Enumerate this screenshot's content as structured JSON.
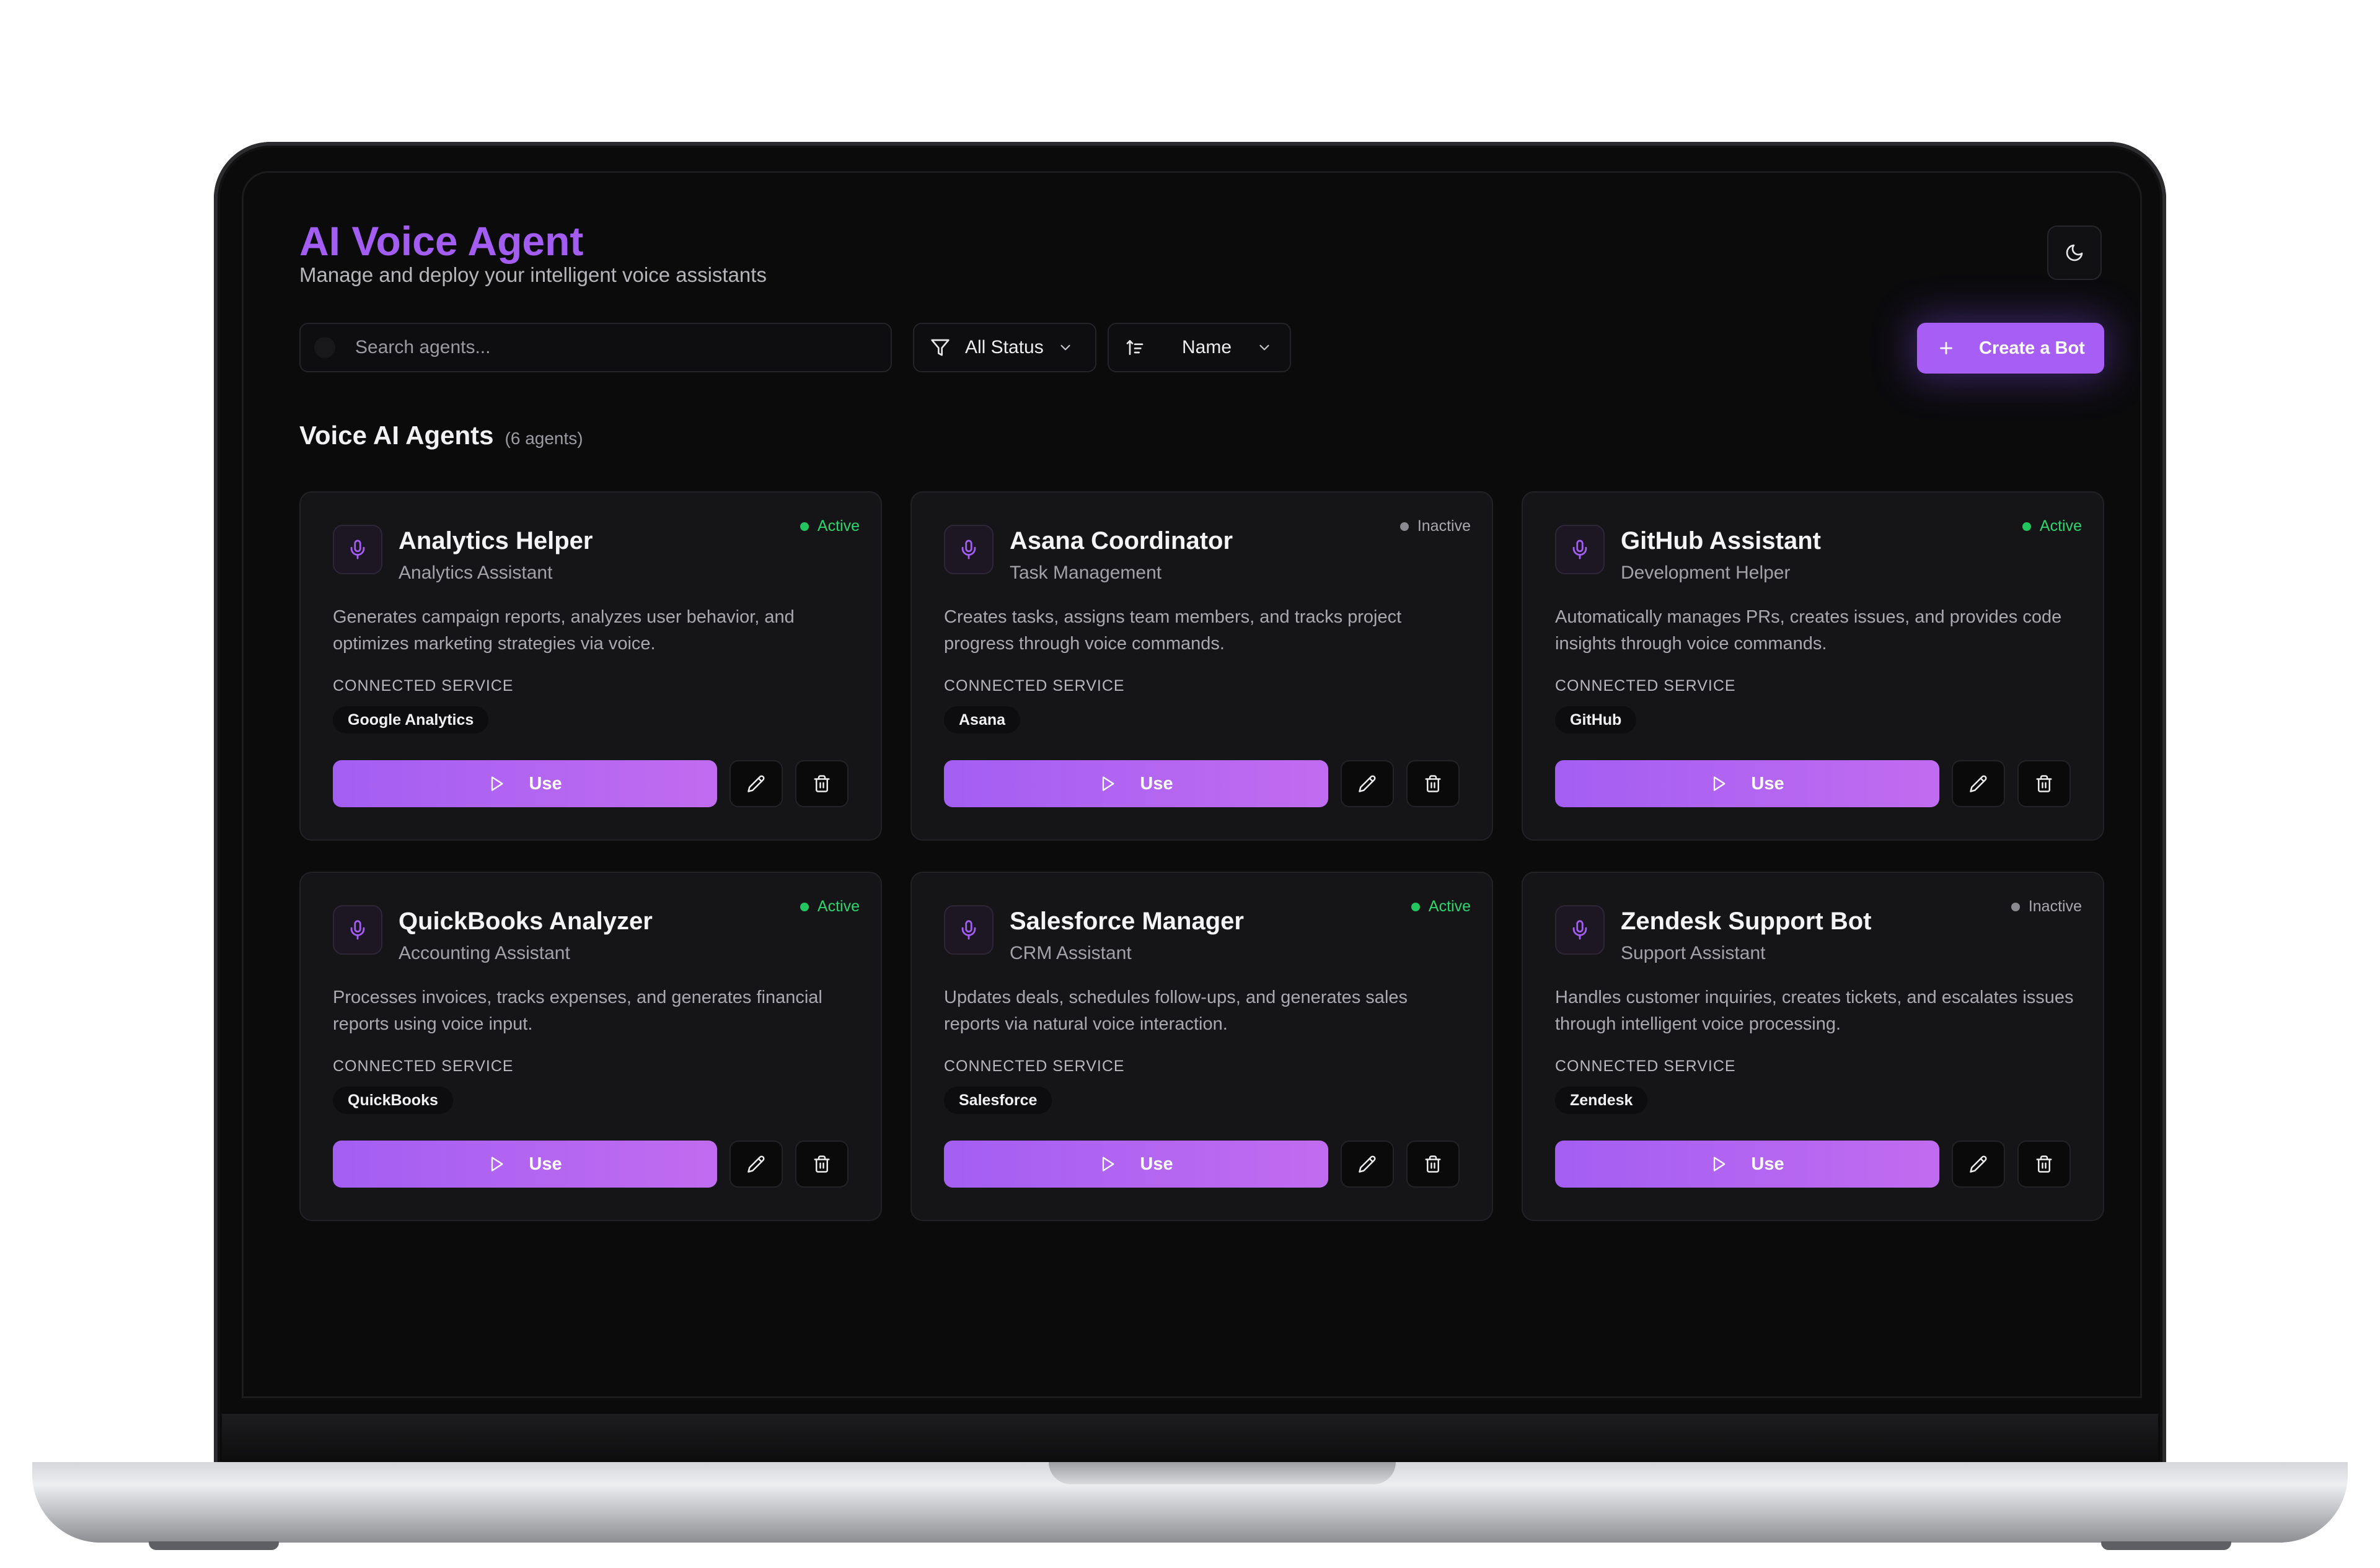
{
  "header": {
    "title": "AI Voice Agent",
    "subtitle": "Manage and deploy your intelligent voice assistants"
  },
  "toolbar": {
    "search_placeholder": "Search agents...",
    "status_filter": "All Status",
    "sort": "Name",
    "create_label": "Create a Bot"
  },
  "section": {
    "title": "Voice AI Agents",
    "count": "(6 agents)"
  },
  "colors": {
    "accent": "#a35df3",
    "active": "#22c55e",
    "inactive": "#8a8a90"
  },
  "card_labels": {
    "connected_service": "CONNECTED SERVICE",
    "use": "Use"
  },
  "agents": [
    {
      "name": "Analytics Helper",
      "role": "Analytics Assistant",
      "status": "Active",
      "description": "Generates campaign reports, analyzes user behavior, and optimizes marketing strategies via voice.",
      "service": "Google Analytics"
    },
    {
      "name": "Asana Coordinator",
      "role": "Task Management",
      "status": "Inactive",
      "description": "Creates tasks, assigns team members, and tracks project progress through voice commands.",
      "service": "Asana"
    },
    {
      "name": "GitHub Assistant",
      "role": "Development Helper",
      "status": "Active",
      "description": "Automatically manages PRs, creates issues, and provides code insights through voice commands.",
      "service": "GitHub"
    },
    {
      "name": "QuickBooks Analyzer",
      "role": "Accounting Assistant",
      "status": "Active",
      "description": "Processes invoices, tracks expenses, and generates financial reports using voice input.",
      "service": "QuickBooks"
    },
    {
      "name": "Salesforce Manager",
      "role": "CRM Assistant",
      "status": "Active",
      "description": "Updates deals, schedules follow-ups, and generates sales reports via natural voice interaction.",
      "service": "Salesforce"
    },
    {
      "name": "Zendesk Support Bot",
      "role": "Support Assistant",
      "status": "Inactive",
      "description": "Handles customer inquiries, creates tickets, and escalates issues through intelligent voice processing.",
      "service": "Zendesk"
    }
  ]
}
